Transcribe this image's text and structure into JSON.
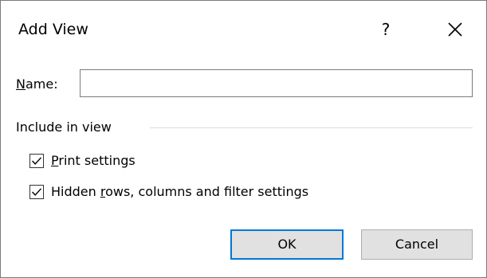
{
  "dialog": {
    "title": "Add View",
    "help_label": "?",
    "close_icon": "close-icon"
  },
  "name_field": {
    "label_mnemonic": "N",
    "label_rest": "ame:",
    "value": "",
    "placeholder": ""
  },
  "include_group": {
    "label": "Include in view",
    "options": [
      {
        "mnemonic": "P",
        "label_rest": "rint settings",
        "label_before": "",
        "checked": true,
        "icon": "checkmark-icon"
      },
      {
        "label_before": "Hidden ",
        "mnemonic": "r",
        "label_rest": "ows, columns and filter settings",
        "checked": true,
        "icon": "checkmark-icon"
      }
    ]
  },
  "buttons": {
    "ok_label": "OK",
    "cancel_label": "Cancel"
  },
  "colors": {
    "accent_focus": "#0078d7",
    "button_face": "#e1e1e1",
    "border": "#7a7a7a"
  }
}
